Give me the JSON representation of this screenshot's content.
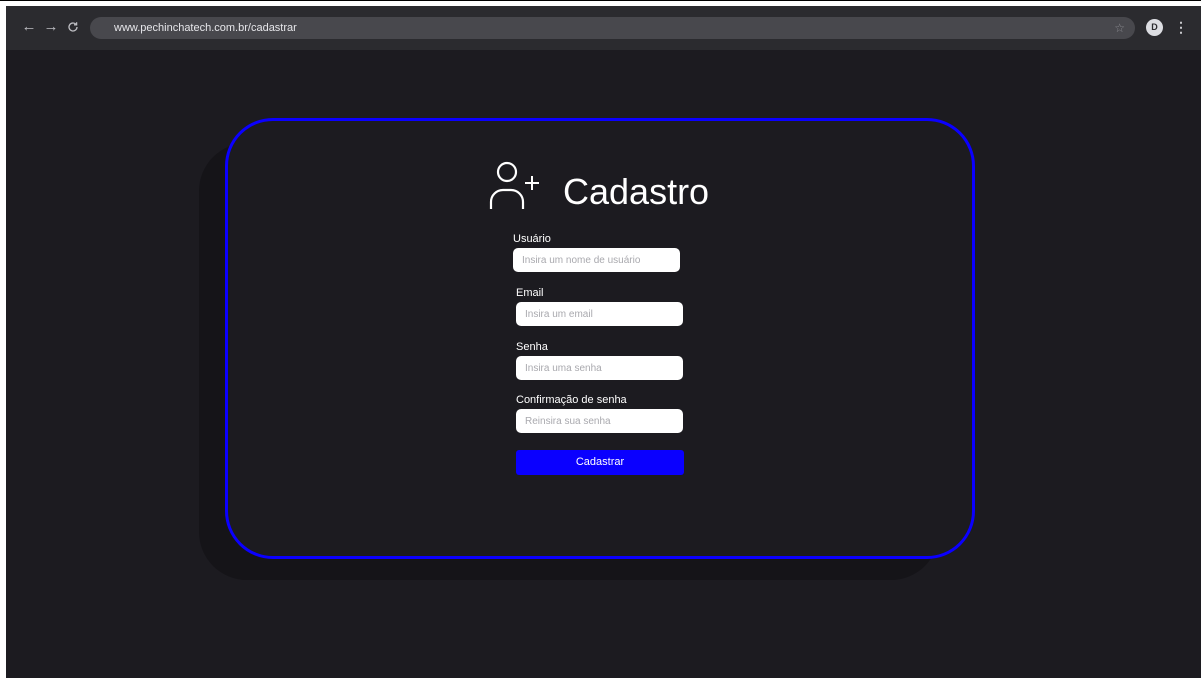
{
  "browser": {
    "back_icon": "arrow-left-icon",
    "forward_icon": "arrow-right-icon",
    "reload_icon": "reload-icon",
    "url": "www.pechinchatech.com.br/cadastrar",
    "bookmark_icon": "star-icon",
    "profile_initial": "D",
    "menu_icon": "more-vertical-icon"
  },
  "form": {
    "icon": "user-plus-icon",
    "title": "Cadastro",
    "fields": [
      {
        "label": "Usuário",
        "value": "",
        "placeholder": "Insira um nome de usuário"
      },
      {
        "label": "Email",
        "value": "",
        "placeholder": "Insira um email"
      },
      {
        "label": "Senha",
        "value": "",
        "placeholder": "Insira uma senha"
      },
      {
        "label": "Confirmação de senha",
        "value": "",
        "placeholder": "Reinsira sua senha"
      }
    ],
    "submit_label": "Cadastrar"
  },
  "colors": {
    "accent": "#0b00ff",
    "background": "#1c1b20",
    "toolbar": "#2b2b2f"
  }
}
